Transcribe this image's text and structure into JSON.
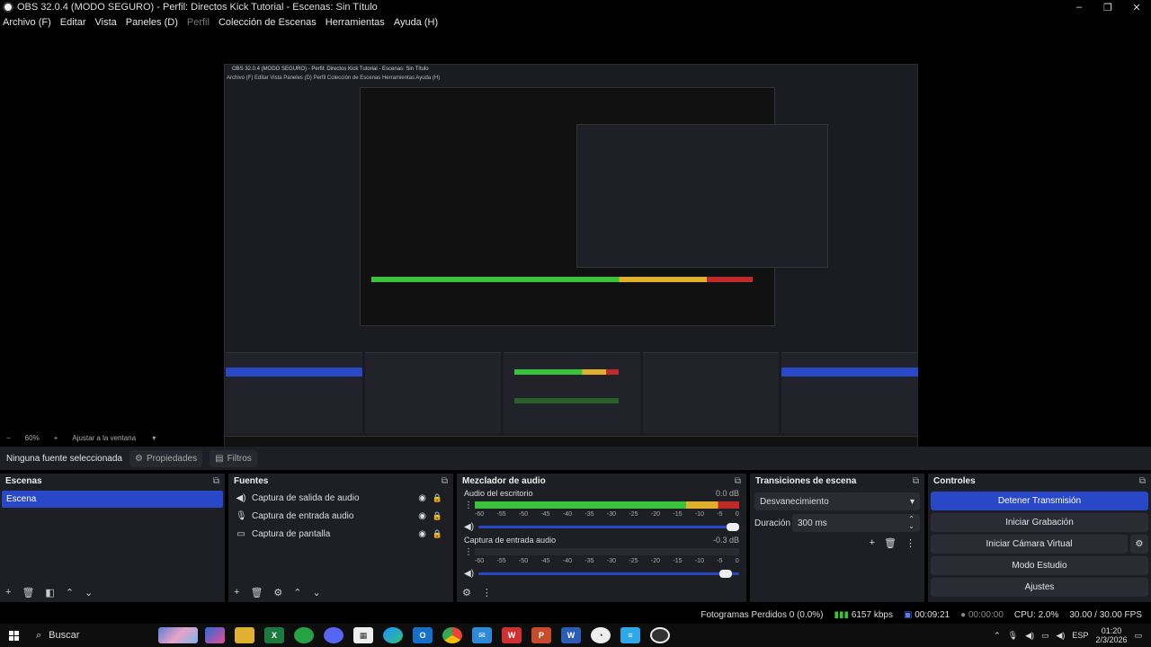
{
  "window": {
    "title": "OBS 32.0.4 (MODO SEGURO) - Perfil: Directos Kick Tutorial - Escenas: Sin Título",
    "minimize": "–",
    "maximize": "❐",
    "close": "✕"
  },
  "menu": {
    "items": [
      "Archivo (F)",
      "Editar",
      "Vista",
      "Paneles (D)",
      "Perfil",
      "Colección de Escenas",
      "Herramientas",
      "Ayuda (H)"
    ]
  },
  "nested": {
    "title": "OBS 32.0.4 (MODO SEGURO) - Perfil: Directos Kick Tutorial - Escenas: Sin Título",
    "menu": "Archivo (F)  Editar  Vista  Paneles (D)  Perfil  Colección de Escenas  Herramientas  Ayuda (H)"
  },
  "zoom": {
    "value": "60%",
    "fit_label": "Ajustar a la ventana"
  },
  "context": {
    "no_source": "Ninguna fuente seleccionada",
    "properties": "Propiedades",
    "filters": "Filtros"
  },
  "scenes": {
    "title": "Escenas",
    "items": [
      "Escena"
    ]
  },
  "sources": {
    "title": "Fuentes",
    "items": [
      {
        "label": "Captura de salida de audio",
        "icon": "speaker-icon"
      },
      {
        "label": "Captura de entrada audio",
        "icon": "mic-icon"
      },
      {
        "label": "Captura de pantalla",
        "icon": "monitor-icon"
      }
    ]
  },
  "mixer": {
    "title": "Mezclador de audio",
    "channels": [
      {
        "name": "Audio del escritorio",
        "db": "0.0 dB",
        "level": 1.0,
        "volume": 1.0
      },
      {
        "name": "Captura de entrada audio",
        "db": "-0.3 dB",
        "level": 0.0,
        "volume": 0.98
      }
    ],
    "ticks": [
      "-60",
      "-55",
      "-50",
      "-45",
      "-40",
      "-35",
      "-30",
      "-25",
      "-20",
      "-15",
      "-10",
      "-5",
      "0"
    ]
  },
  "transitions": {
    "title": "Transiciones de escena",
    "selected": "Desvanecimiento",
    "duration_label": "Duración",
    "duration_value": "300 ms"
  },
  "controls": {
    "title": "Controles",
    "stop_stream": "Detener Transmisión",
    "start_recording": "Iniciar Grabación",
    "start_virtualcam": "Iniciar Cámara Virtual",
    "studio_mode": "Modo Estudio",
    "settings": "Ajustes"
  },
  "status": {
    "dropped": "Fotogramas Perdidos 0 (0.0%)",
    "bitrate": "6157 kbps",
    "stream_time": "00:09:21",
    "rec_time": "00:00:00",
    "cpu": "CPU: 2.0%",
    "fps": "30.00 / 30.00 FPS"
  },
  "taskbar": {
    "search": "Buscar",
    "lang": "ESP",
    "time": "01:20",
    "date": "2/3/2026"
  },
  "colors": {
    "accent": "#2848c8",
    "meter_green": "#3ac23a",
    "meter_yellow": "#e0b02c",
    "meter_red": "#c02a2a"
  }
}
